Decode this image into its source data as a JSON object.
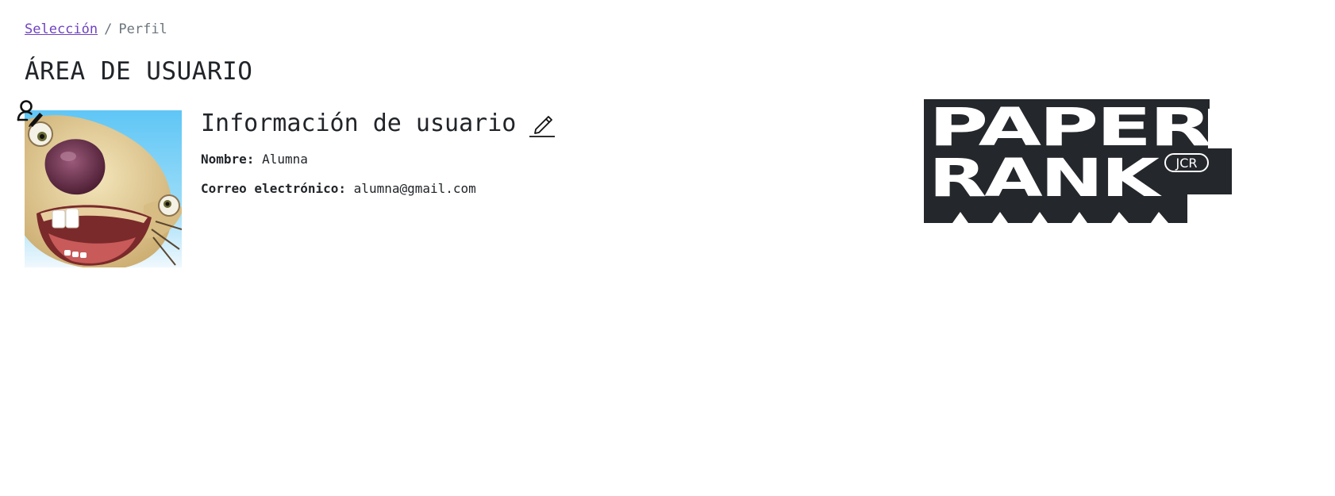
{
  "breadcrumb": {
    "link": "Selección",
    "separator": "/",
    "current": "Perfil"
  },
  "page": {
    "title": "ÁREA DE USUARIO"
  },
  "user_info": {
    "title": "Información de usuario",
    "name_label": "Nombre:",
    "name_value": "Alumna",
    "email_label": "Correo electrónico:",
    "email_value": "alumna@gmail.com"
  },
  "icons": {
    "avatar_edit": "user-pen-icon",
    "edit_info": "pencil-icon"
  },
  "logo": {
    "line1": "PAPER",
    "line2": "RANK",
    "badge": "JCR"
  },
  "colors": {
    "link": "#6f42c1",
    "text": "#212529",
    "muted": "#6c757d",
    "logo_dark": "#24272b"
  }
}
